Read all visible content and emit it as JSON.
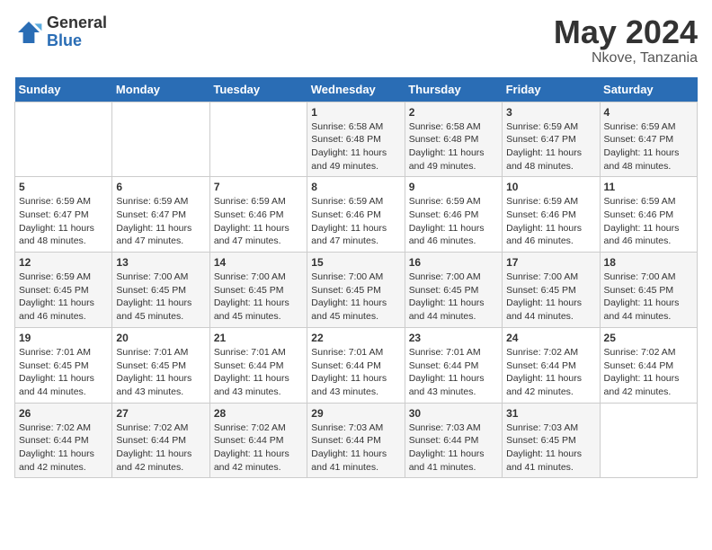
{
  "header": {
    "logo_general": "General",
    "logo_blue": "Blue",
    "month_year": "May 2024",
    "location": "Nkove, Tanzania"
  },
  "weekdays": [
    "Sunday",
    "Monday",
    "Tuesday",
    "Wednesday",
    "Thursday",
    "Friday",
    "Saturday"
  ],
  "weeks": [
    [
      {
        "day": null,
        "info": null
      },
      {
        "day": null,
        "info": null
      },
      {
        "day": null,
        "info": null
      },
      {
        "day": "1",
        "sunrise": "6:58 AM",
        "sunset": "6:48 PM",
        "daylight": "11 hours and 49 minutes."
      },
      {
        "day": "2",
        "sunrise": "6:58 AM",
        "sunset": "6:48 PM",
        "daylight": "11 hours and 49 minutes."
      },
      {
        "day": "3",
        "sunrise": "6:59 AM",
        "sunset": "6:47 PM",
        "daylight": "11 hours and 48 minutes."
      },
      {
        "day": "4",
        "sunrise": "6:59 AM",
        "sunset": "6:47 PM",
        "daylight": "11 hours and 48 minutes."
      }
    ],
    [
      {
        "day": "5",
        "sunrise": "6:59 AM",
        "sunset": "6:47 PM",
        "daylight": "11 hours and 48 minutes."
      },
      {
        "day": "6",
        "sunrise": "6:59 AM",
        "sunset": "6:47 PM",
        "daylight": "11 hours and 47 minutes."
      },
      {
        "day": "7",
        "sunrise": "6:59 AM",
        "sunset": "6:46 PM",
        "daylight": "11 hours and 47 minutes."
      },
      {
        "day": "8",
        "sunrise": "6:59 AM",
        "sunset": "6:46 PM",
        "daylight": "11 hours and 47 minutes."
      },
      {
        "day": "9",
        "sunrise": "6:59 AM",
        "sunset": "6:46 PM",
        "daylight": "11 hours and 46 minutes."
      },
      {
        "day": "10",
        "sunrise": "6:59 AM",
        "sunset": "6:46 PM",
        "daylight": "11 hours and 46 minutes."
      },
      {
        "day": "11",
        "sunrise": "6:59 AM",
        "sunset": "6:46 PM",
        "daylight": "11 hours and 46 minutes."
      }
    ],
    [
      {
        "day": "12",
        "sunrise": "6:59 AM",
        "sunset": "6:45 PM",
        "daylight": "11 hours and 46 minutes."
      },
      {
        "day": "13",
        "sunrise": "7:00 AM",
        "sunset": "6:45 PM",
        "daylight": "11 hours and 45 minutes."
      },
      {
        "day": "14",
        "sunrise": "7:00 AM",
        "sunset": "6:45 PM",
        "daylight": "11 hours and 45 minutes."
      },
      {
        "day": "15",
        "sunrise": "7:00 AM",
        "sunset": "6:45 PM",
        "daylight": "11 hours and 45 minutes."
      },
      {
        "day": "16",
        "sunrise": "7:00 AM",
        "sunset": "6:45 PM",
        "daylight": "11 hours and 44 minutes."
      },
      {
        "day": "17",
        "sunrise": "7:00 AM",
        "sunset": "6:45 PM",
        "daylight": "11 hours and 44 minutes."
      },
      {
        "day": "18",
        "sunrise": "7:00 AM",
        "sunset": "6:45 PM",
        "daylight": "11 hours and 44 minutes."
      }
    ],
    [
      {
        "day": "19",
        "sunrise": "7:01 AM",
        "sunset": "6:45 PM",
        "daylight": "11 hours and 44 minutes."
      },
      {
        "day": "20",
        "sunrise": "7:01 AM",
        "sunset": "6:45 PM",
        "daylight": "11 hours and 43 minutes."
      },
      {
        "day": "21",
        "sunrise": "7:01 AM",
        "sunset": "6:44 PM",
        "daylight": "11 hours and 43 minutes."
      },
      {
        "day": "22",
        "sunrise": "7:01 AM",
        "sunset": "6:44 PM",
        "daylight": "11 hours and 43 minutes."
      },
      {
        "day": "23",
        "sunrise": "7:01 AM",
        "sunset": "6:44 PM",
        "daylight": "11 hours and 43 minutes."
      },
      {
        "day": "24",
        "sunrise": "7:02 AM",
        "sunset": "6:44 PM",
        "daylight": "11 hours and 42 minutes."
      },
      {
        "day": "25",
        "sunrise": "7:02 AM",
        "sunset": "6:44 PM",
        "daylight": "11 hours and 42 minutes."
      }
    ],
    [
      {
        "day": "26",
        "sunrise": "7:02 AM",
        "sunset": "6:44 PM",
        "daylight": "11 hours and 42 minutes."
      },
      {
        "day": "27",
        "sunrise": "7:02 AM",
        "sunset": "6:44 PM",
        "daylight": "11 hours and 42 minutes."
      },
      {
        "day": "28",
        "sunrise": "7:02 AM",
        "sunset": "6:44 PM",
        "daylight": "11 hours and 42 minutes."
      },
      {
        "day": "29",
        "sunrise": "7:03 AM",
        "sunset": "6:44 PM",
        "daylight": "11 hours and 41 minutes."
      },
      {
        "day": "30",
        "sunrise": "7:03 AM",
        "sunset": "6:44 PM",
        "daylight": "11 hours and 41 minutes."
      },
      {
        "day": "31",
        "sunrise": "7:03 AM",
        "sunset": "6:45 PM",
        "daylight": "11 hours and 41 minutes."
      },
      {
        "day": null,
        "info": null
      }
    ]
  ],
  "labels": {
    "sunrise_prefix": "Sunrise: ",
    "sunset_prefix": "Sunset: ",
    "daylight_prefix": "Daylight: "
  }
}
